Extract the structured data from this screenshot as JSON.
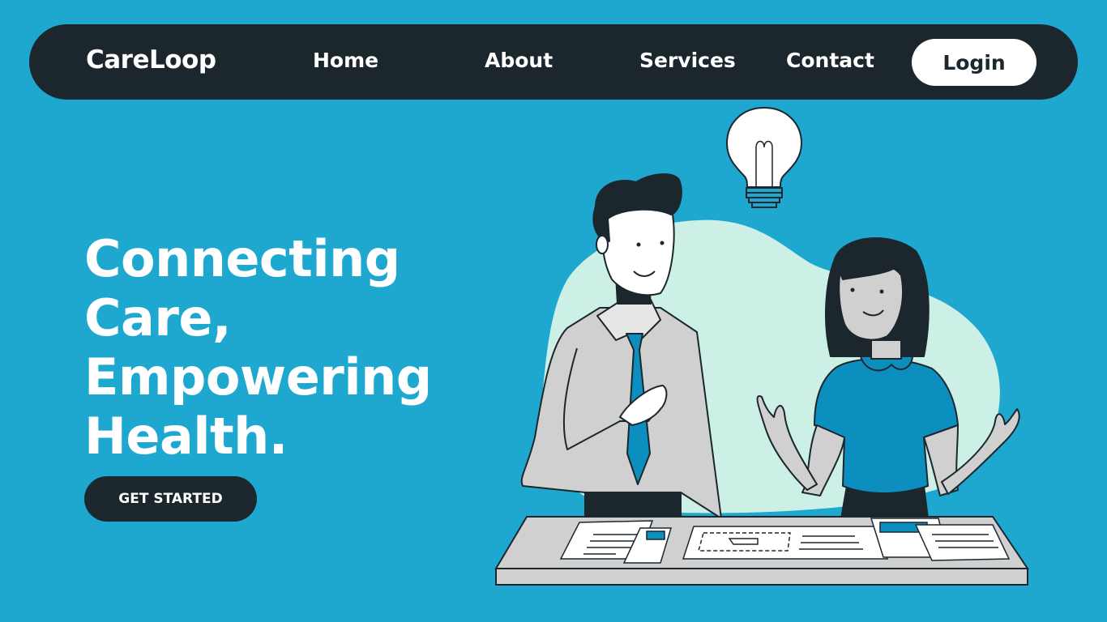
{
  "nav": {
    "brand": "CareLoop",
    "links": [
      "Home",
      "About",
      "Services",
      "Contact"
    ],
    "login_label": "Login"
  },
  "hero": {
    "headline": [
      "Connecting",
      "Care,",
      "Empowering",
      "Health."
    ],
    "cta_label": "GET STARTED"
  },
  "illustration": {
    "icons": [
      "lightbulb-icon",
      "man-figure",
      "woman-figure",
      "desk",
      "documents"
    ]
  },
  "colors": {
    "background": "#1fa8cf",
    "dark": "#1c262d",
    "accent": "#0c8fbf",
    "blob": "#cdf0e6",
    "light": "#ffffff"
  }
}
